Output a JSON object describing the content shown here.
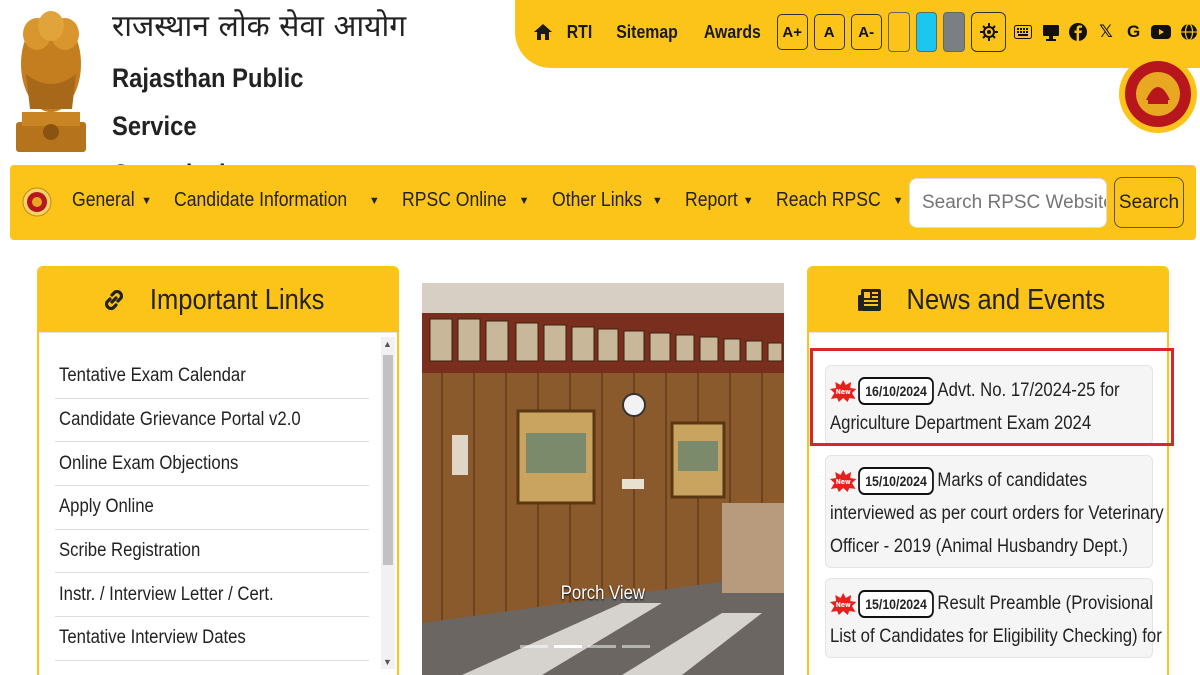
{
  "header": {
    "title_hindi": "राजस्थान लोक सेवा आयोग",
    "title_english_line1": "Rajasthan Public Service",
    "title_english_line2": "Commission"
  },
  "topbar": {
    "links": [
      "RTI",
      "Sitemap",
      "Awards"
    ],
    "font_buttons": [
      "A+",
      "A",
      "A-"
    ],
    "theme_swatches": [
      "#fcc419",
      "#19c7ef",
      "#7a7f84"
    ],
    "social_icons": [
      "keyboard-icon",
      "monitor-icon",
      "facebook-icon",
      "x-icon",
      "google-icon",
      "youtube-icon",
      "globe-icon"
    ]
  },
  "nav": {
    "items": [
      "General",
      "Candidate Information",
      "RPSC Online",
      "Other Links",
      "Report",
      "Reach RPSC"
    ],
    "search_placeholder": "Search RPSC Website",
    "search_label": "Search"
  },
  "important_links": {
    "title": "Important Links",
    "items": [
      "Tentative Exam Calendar",
      "Candidate Grievance Portal v2.0",
      "Online Exam Objections",
      "Apply Online",
      "Scribe Registration",
      "Instr. / Interview Letter / Cert.",
      "Tentative Interview Dates"
    ]
  },
  "slider": {
    "caption": "Porch View",
    "slide_count": 4,
    "active_index": 1
  },
  "news": {
    "title": "News and Events",
    "items": [
      {
        "date": "16/10/2024",
        "line1": "Advt. No. 17/2024-25 for",
        "line2": "Agriculture Department Exam 2024",
        "line3": ""
      },
      {
        "date": "15/10/2024",
        "line1": "Marks of candidates",
        "line2": "interviewed as per court orders for Veterinary",
        "line3": "Officer - 2019 (Animal Husbandry Dept.)"
      },
      {
        "date": "15/10/2024",
        "line1": "Result Preamble (Provisional",
        "line2": "List of Candidates for Eligibility Checking) for",
        "line3": ""
      }
    ]
  },
  "colors": {
    "accent": "#fcc419",
    "highlight": "#d62828"
  }
}
